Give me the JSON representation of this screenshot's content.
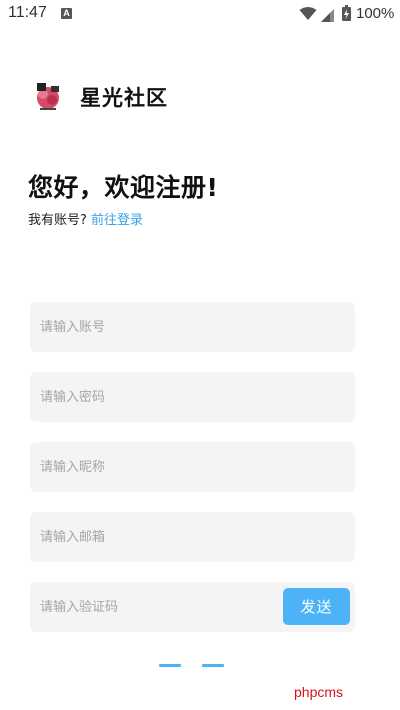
{
  "status_bar": {
    "time": "11:47",
    "notification_icon": "A",
    "battery": "100%",
    "icons": [
      "wifi-icon",
      "signal-icon",
      "battery-icon"
    ]
  },
  "brand": {
    "name": "星光社区",
    "logo_icon": "brand-logo-icon"
  },
  "heading": {
    "title": "您好，欢迎注册!",
    "prompt": "我有账号?",
    "login_link": "前往登录"
  },
  "form": {
    "account_placeholder": "请输入账号",
    "password_placeholder": "请输入密码",
    "nickname_placeholder": "请输入昵称",
    "email_placeholder": "请输入邮箱",
    "code_placeholder": "请输入验证码",
    "send_label": "发送"
  },
  "watermark": "phpcms",
  "colors": {
    "accent": "#4cb4f6",
    "link": "#3aa3e6",
    "field_bg": "#f4f4f4",
    "watermark": "#d6121a"
  }
}
